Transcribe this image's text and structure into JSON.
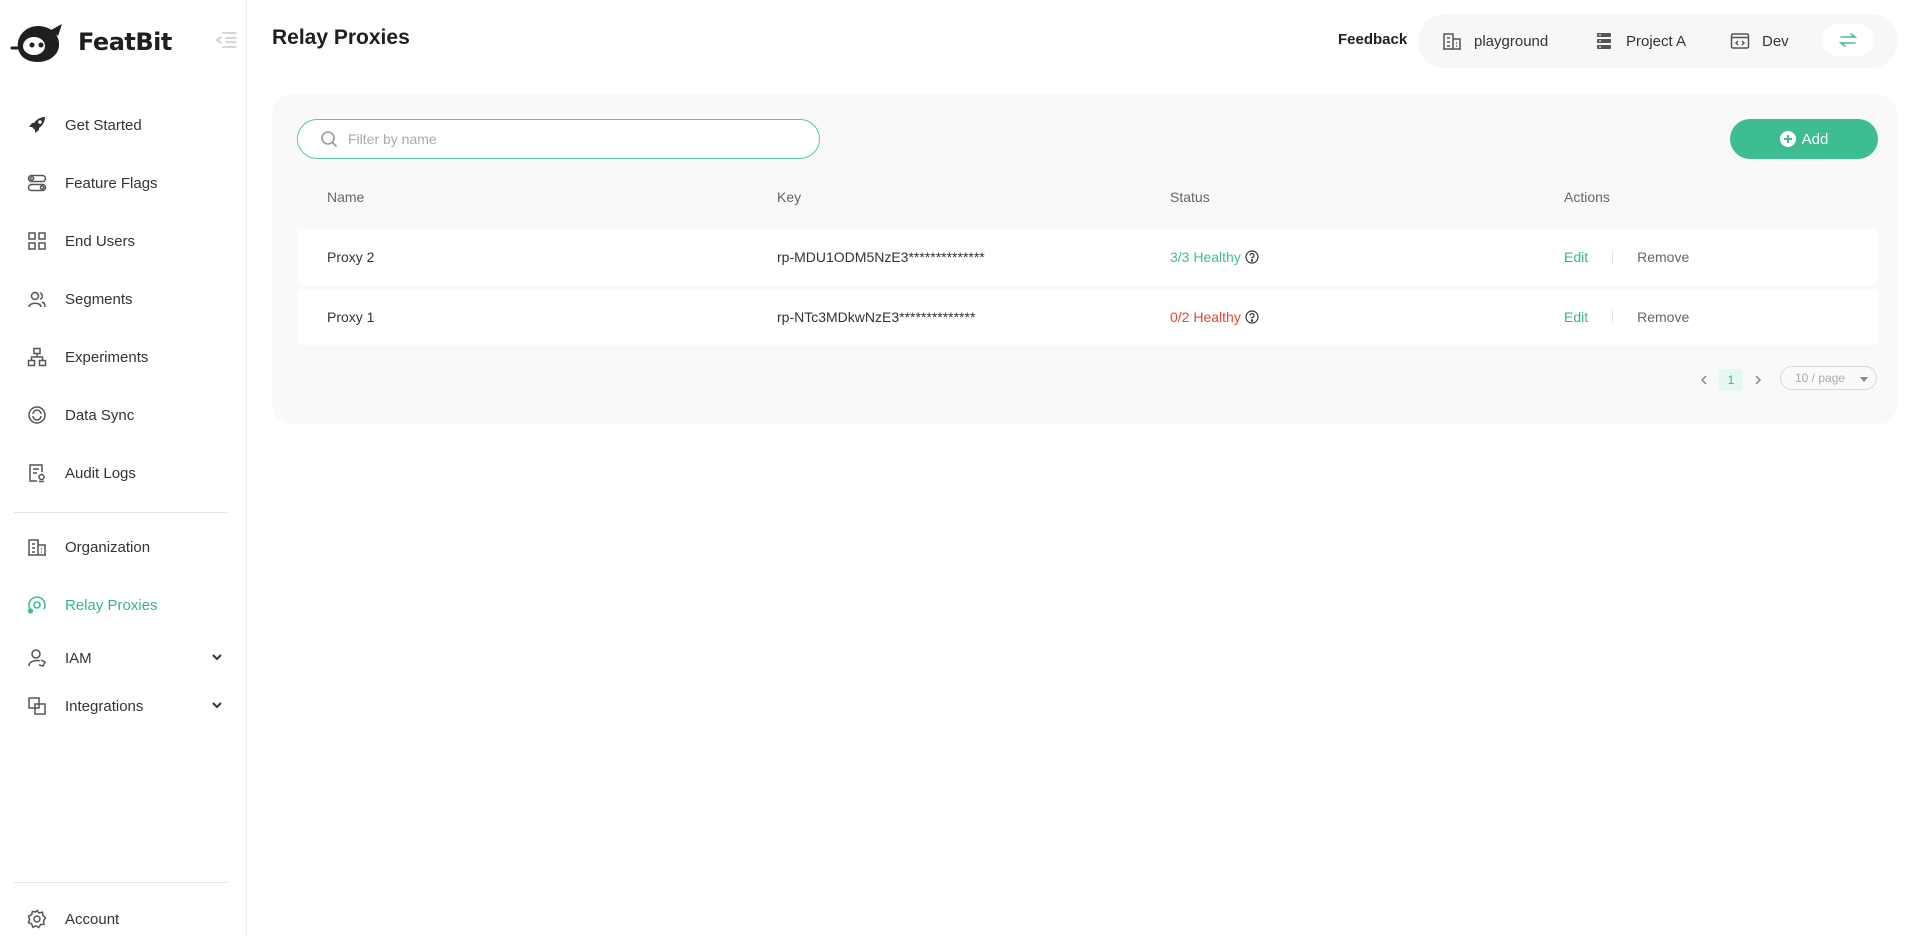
{
  "brand": {
    "name": "FeatBit"
  },
  "sidebar": {
    "items": [
      {
        "label": "Get Started",
        "icon": "rocket-icon"
      },
      {
        "label": "Feature Flags",
        "icon": "toggle-icon"
      },
      {
        "label": "End Users",
        "icon": "grid-icon"
      },
      {
        "label": "Segments",
        "icon": "users-icon"
      },
      {
        "label": "Experiments",
        "icon": "hierarchy-icon"
      },
      {
        "label": "Data Sync",
        "icon": "sync-icon"
      },
      {
        "label": "Audit Logs",
        "icon": "audit-icon"
      },
      {
        "label": "Organization",
        "icon": "building-icon"
      },
      {
        "label": "Relay Proxies",
        "icon": "relay-icon",
        "active": true
      },
      {
        "label": "IAM",
        "icon": "user-shield-icon",
        "expandable": true
      },
      {
        "label": "Integrations",
        "icon": "integrations-icon",
        "expandable": true
      }
    ],
    "account_label": "Account"
  },
  "header": {
    "title": "Relay Proxies",
    "feedback": "Feedback",
    "organization": "playground",
    "project": "Project A",
    "environment": "Dev"
  },
  "search": {
    "placeholder": "Filter by name",
    "value": ""
  },
  "add_label": "Add",
  "table": {
    "columns": [
      "Name",
      "Key",
      "Status",
      "Actions"
    ],
    "rows": [
      {
        "name": "Proxy 2",
        "key": "rp-MDU1ODM5NzE3**************",
        "status": "3/3 Healthy",
        "healthy": true
      },
      {
        "name": "Proxy 1",
        "key": "rp-NTc3MDkwNzE3**************",
        "status": "0/2 Healthy",
        "healthy": false
      }
    ],
    "edit_label": "Edit",
    "remove_label": "Remove"
  },
  "pagination": {
    "current": "1",
    "page_size": "10 / page"
  },
  "colors": {
    "accent": "#3ebd93",
    "error": "#e8452c"
  }
}
